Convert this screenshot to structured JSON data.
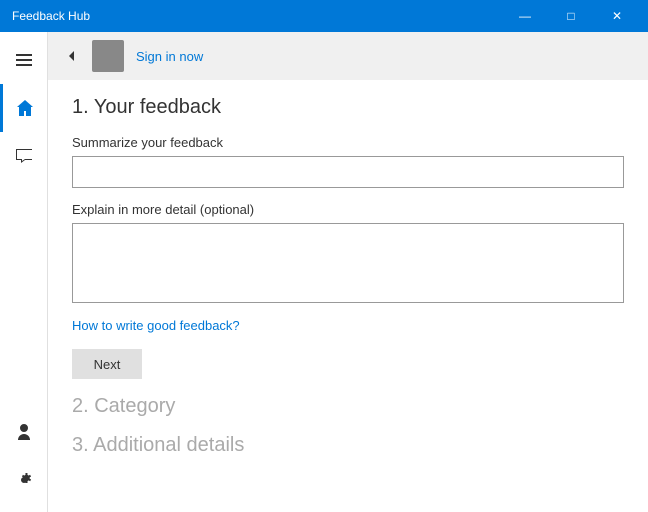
{
  "titleBar": {
    "title": "Feedback Hub",
    "minimize": "—",
    "maximize": "□",
    "close": "✕"
  },
  "topBar": {
    "signInText": "Sign in now"
  },
  "sidebar": {
    "items": [
      {
        "id": "hamburger",
        "icon": "menu"
      },
      {
        "id": "home",
        "icon": "home"
      },
      {
        "id": "feedback",
        "icon": "chat"
      }
    ],
    "bottomItems": [
      {
        "id": "account",
        "icon": "person"
      },
      {
        "id": "settings",
        "icon": "gear"
      }
    ]
  },
  "sections": {
    "section1": {
      "label": "1. Your feedback",
      "summaryLabel": "Summarize your feedback",
      "summaryPlaceholder": "",
      "detailLabel": "Explain in more detail (optional)",
      "detailPlaceholder": "",
      "helpLink": "How to write good feedback?",
      "nextButton": "Next"
    },
    "section2": {
      "label": "2. Category"
    },
    "section3": {
      "label": "3. Additional details"
    }
  }
}
